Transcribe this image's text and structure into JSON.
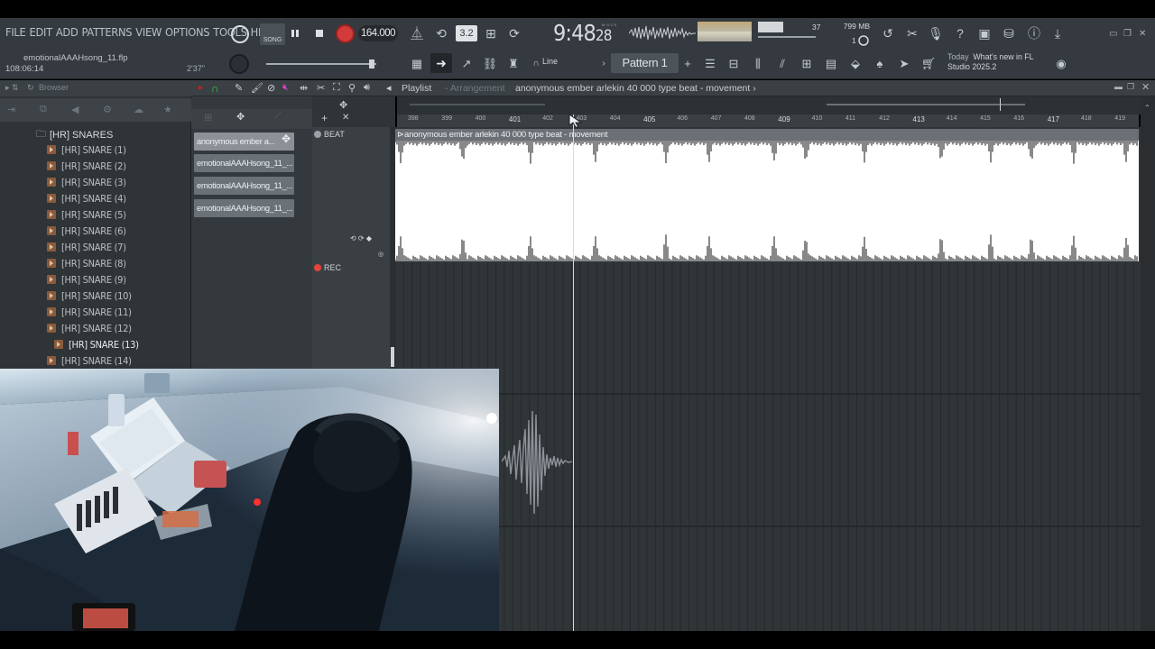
{
  "menu": [
    "FILE",
    "EDIT",
    "ADD",
    "PATTERNS",
    "VIEW",
    "OPTIONS",
    "TOOLS",
    "HELP"
  ],
  "project": {
    "name": "emotionalAAAHsong_11.flp",
    "elapsed": "108:06:14",
    "length": "2'37\""
  },
  "transport": {
    "mode_label": "SONG",
    "bpm": "164.000",
    "step": "3.2"
  },
  "clock": {
    "main": "9:48",
    "sub": "28",
    "labels": "M:S:CS"
  },
  "cpu": {
    "value": "37"
  },
  "memory": {
    "used": "799 MB",
    "polyphony": "1"
  },
  "toolbar2": {
    "snap": "Line",
    "pattern": "Pattern 1"
  },
  "news": {
    "when": "Today",
    "headline": "What's new in FL",
    "version": "Studio 2025.2"
  },
  "browser": {
    "title": "Browser",
    "root_folder": "[HR] SNARES",
    "items": [
      "[HR] SNARE (1)",
      "[HR] SNARE (2)",
      "[HR] SNARE (3)",
      "[HR] SNARE (4)",
      "[HR] SNARE (5)",
      "[HR] SNARE (6)",
      "[HR] SNARE (7)",
      "[HR] SNARE (8)",
      "[HR] SNARE (9)",
      "[HR] SNARE (10)",
      "[HR] SNARE (11)",
      "[HR] SNARE (12)",
      "[HR] SNARE (13)",
      "[HR] SNARE (14)"
    ],
    "selected_index": 12
  },
  "picker": {
    "clips": [
      "anonymous ember  a...",
      "emotionalAAAHsong_11_...",
      "emotionalAAAHsong_11_...",
      "emotionalAAAHsong_11_..."
    ]
  },
  "playlist": {
    "title": "Playlist",
    "subtitle": "Arrangement",
    "name": "anonymous ember  arlekin 40 000 type beat - movement",
    "tracks": [
      {
        "label": "BEAT",
        "color": "#9aa0a5"
      },
      {
        "label": "REC",
        "color": "#e0463c"
      }
    ],
    "clip_name": "anonymous ember  arlekin 40 000 type beat - movement",
    "ruler": [
      {
        "bar": "398",
        "major": false
      },
      {
        "bar": "399",
        "major": false
      },
      {
        "bar": "400",
        "major": false
      },
      {
        "bar": "401",
        "major": true
      },
      {
        "bar": "402",
        "major": false
      },
      {
        "bar": "403",
        "major": false
      },
      {
        "bar": "404",
        "major": false
      },
      {
        "bar": "405",
        "major": true
      },
      {
        "bar": "406",
        "major": false
      },
      {
        "bar": "407",
        "major": false
      },
      {
        "bar": "408",
        "major": false
      },
      {
        "bar": "409",
        "major": true
      },
      {
        "bar": "410",
        "major": false
      },
      {
        "bar": "411",
        "major": false
      },
      {
        "bar": "412",
        "major": false
      },
      {
        "bar": "413",
        "major": true
      },
      {
        "bar": "414",
        "major": false
      },
      {
        "bar": "415",
        "major": false
      },
      {
        "bar": "416",
        "major": false
      },
      {
        "bar": "417",
        "major": true
      },
      {
        "bar": "418",
        "major": false
      },
      {
        "bar": "419",
        "major": false
      }
    ]
  },
  "colors": {
    "accent": "#d13b3b",
    "panel": "#343a3f",
    "waveform": "#ffffff",
    "rec": "#e0463c"
  }
}
